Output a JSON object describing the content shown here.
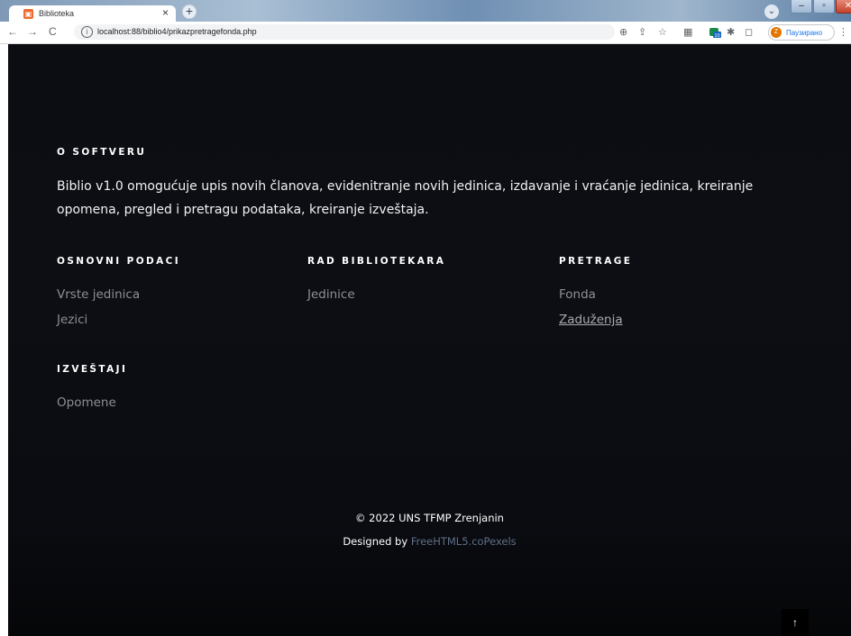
{
  "browser": {
    "tab_title": "Biblioteka",
    "tab_close": "×",
    "new_tab": "+",
    "url": "localhost:88/biblio4/prikazpretragefonda.php",
    "profile_status": "Паузирано",
    "profile_initial": "Z",
    "ext_badge": "10"
  },
  "about": {
    "heading": "O SOFTVERU",
    "text": "Biblio v1.0 omogućuje upis novih članova, evidenitranje novih jedinica, izdavanje i vraćanje jedinica, kreiranje opomena, pregled i pretragu podataka, kreiranje izveštaja."
  },
  "sections": {
    "osnovni": {
      "heading": "OSNOVNI PODACI",
      "links": [
        "Vrste jedinica",
        "Jezici"
      ]
    },
    "rad": {
      "heading": "RAD BIBLIOTEKARA",
      "links": [
        "Jedinice"
      ]
    },
    "pretrage": {
      "heading": "PRETRAGE",
      "links": [
        "Fonda",
        "Zaduženja"
      ]
    },
    "izvestaji": {
      "heading": "IZVEŠTAJI",
      "links": [
        "Opomene"
      ]
    }
  },
  "footer": {
    "copyright": "© 2022 UNS TFMP Zrenjanin",
    "designed_by": "Designed by",
    "credit": "FreeHTML5.coPexels"
  },
  "back_to_top": "↑",
  "colors": {
    "page_bg": "#0b0d12",
    "link": "#8d8f93",
    "credit": "#5f6f86"
  }
}
